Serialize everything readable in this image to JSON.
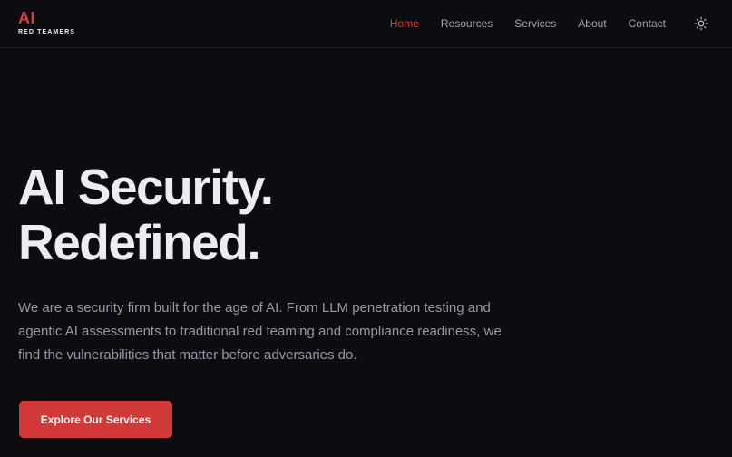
{
  "brand": {
    "mark": "AI",
    "name": "RED TEAMERS",
    "accent_color": "#dc3c3a"
  },
  "nav": {
    "items": [
      {
        "label": "Home",
        "active": true
      },
      {
        "label": "Resources",
        "active": false
      },
      {
        "label": "Services",
        "active": false
      },
      {
        "label": "About",
        "active": false
      },
      {
        "label": "Contact",
        "active": false
      }
    ],
    "theme_toggle_icon": "sun-icon"
  },
  "hero": {
    "title_line1": "AI Security.",
    "title_line2": "Redefined.",
    "description": "We are a security firm built for the age of AI. From LLM penetration testing and agentic AI assessments to traditional red teaming and compliance readiness, we find the vulnerabilities that matter before adversaries do.",
    "cta_label": "Explore Our Services"
  },
  "colors": {
    "background": "#0c0c11",
    "text_primary": "#ececf1",
    "text_secondary": "#9898a6",
    "button": "#d13a38"
  }
}
